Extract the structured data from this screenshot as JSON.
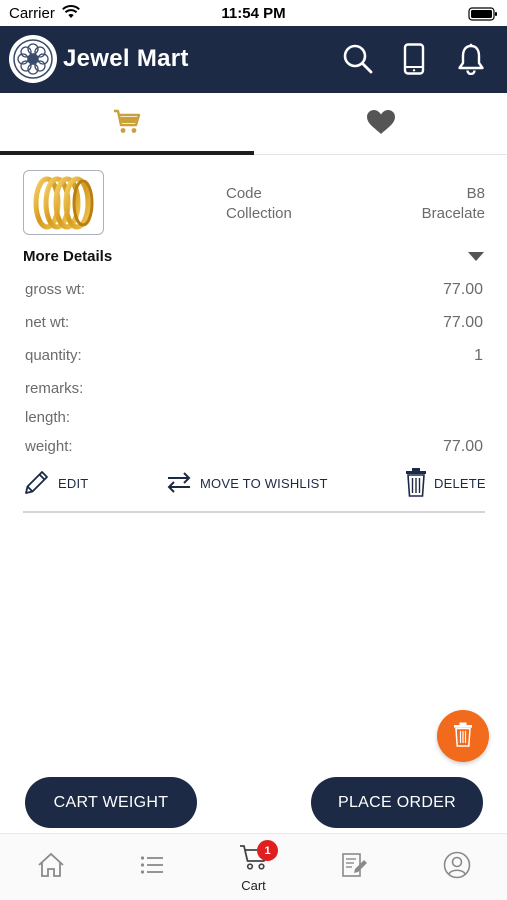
{
  "status_bar": {
    "carrier": "Carrier",
    "time": "11:54 PM"
  },
  "header": {
    "title": "Jewel Mart"
  },
  "tabs": [
    {
      "icon": "cart-icon",
      "active": true
    },
    {
      "icon": "heart-icon",
      "active": false
    }
  ],
  "item": {
    "code_label": "Code",
    "code_value": "B8",
    "collection_label": "Collection",
    "collection_value": "Bracelate",
    "more_details_label": "More Details",
    "details": [
      {
        "label": "gross wt:",
        "value": "77.00"
      },
      {
        "label": "net wt:",
        "value": "77.00"
      },
      {
        "label": "quantity:",
        "value": "1"
      },
      {
        "label": "remarks:",
        "value": ""
      },
      {
        "label": "length:",
        "value": ""
      },
      {
        "label": "weight:",
        "value": "77.00"
      }
    ],
    "actions": {
      "edit": "EDIT",
      "move": "MOVE TO WISHLIST",
      "delete": "DELETE"
    }
  },
  "buttons": {
    "cart_weight": "CART WEIGHT",
    "place_order": "PLACE ORDER"
  },
  "tabbar": {
    "items": [
      {
        "icon": "home-icon",
        "label": ""
      },
      {
        "icon": "list-icon",
        "label": ""
      },
      {
        "icon": "cart-icon",
        "label": "Cart",
        "badge": "1"
      },
      {
        "icon": "edit-catalog-icon",
        "label": ""
      },
      {
        "icon": "profile-icon",
        "label": ""
      }
    ]
  },
  "colors": {
    "header_bg": "#1c2a45",
    "accent_gold": "#c9a13b",
    "fab_orange": "#f26a1b",
    "badge_red": "#e02020"
  }
}
